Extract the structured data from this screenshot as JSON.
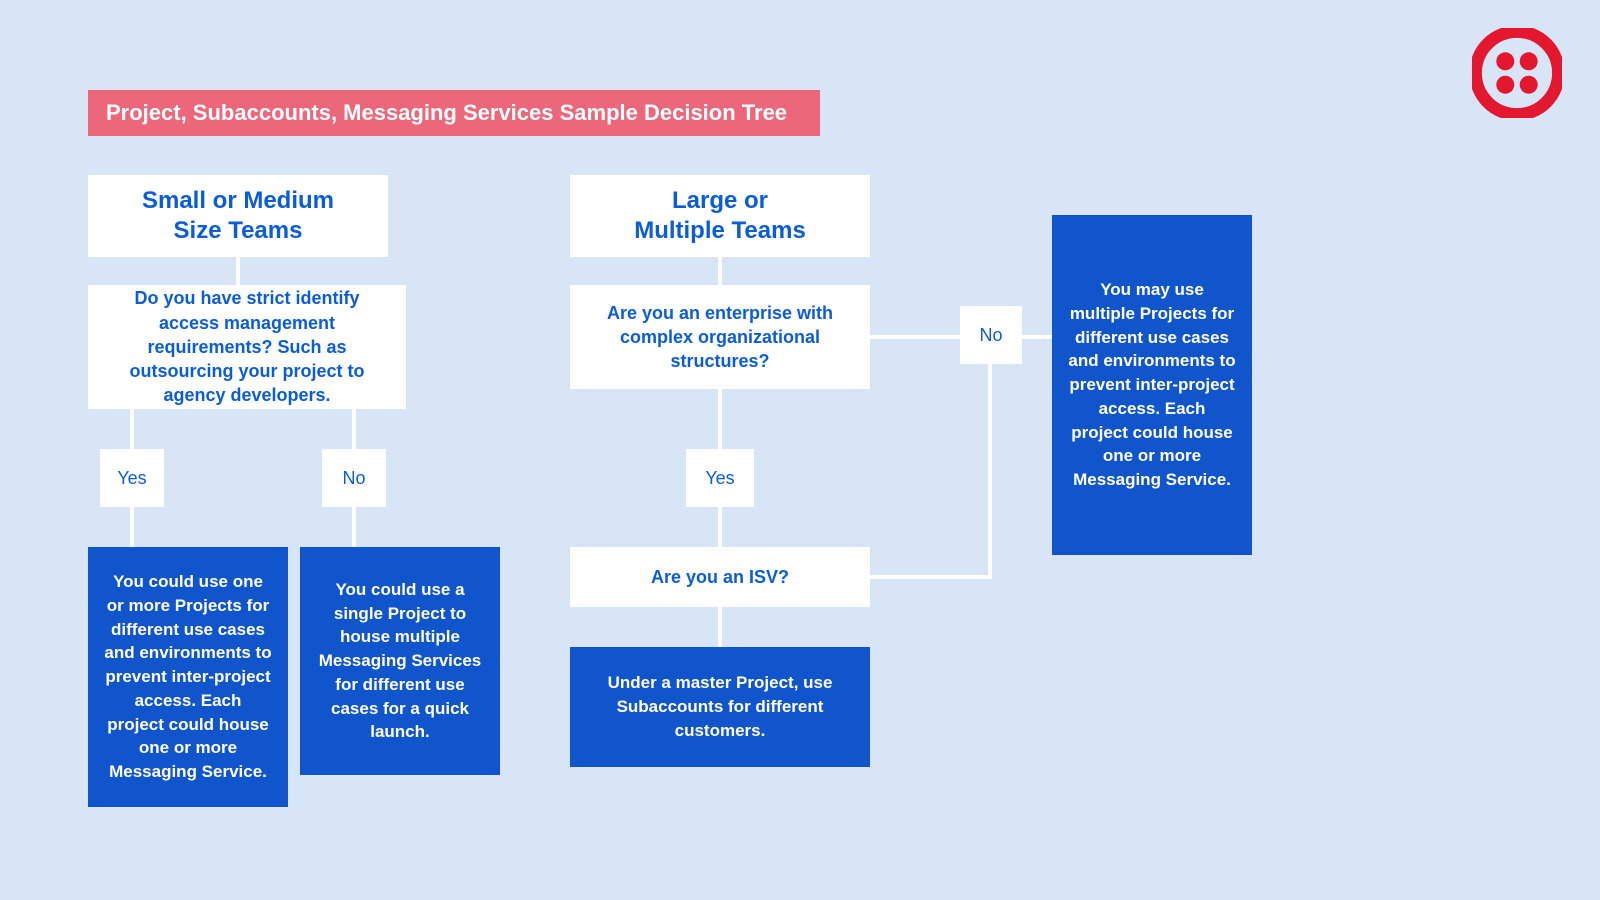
{
  "title": "Project, Subaccounts, Messaging Services Sample Decision Tree",
  "small": {
    "heading": "Small or Medium\nSize Teams",
    "q1": "Do you have strict identify access management requirements? Such as outsourcing your project to agency developers.",
    "yes": "Yes",
    "no": "No",
    "yes_result": "You could use  one or more Projects for different use cases and environments to prevent inter-project access. Each project could house one or more Messaging Service.",
    "no_result": "You could use a single Project to house multiple Messaging Services for different use cases for a quick launch."
  },
  "large": {
    "heading": "Large or\nMultiple Teams",
    "q1": "Are you an enterprise with complex organizational structures?",
    "yes": "Yes",
    "no": "No",
    "q2": "Are you an ISV?",
    "isv_result": "Under a master Project, use Subaccounts for different customers.",
    "no_result": "You may use multiple Projects for different use cases and environments to prevent inter-project access. Each project could house one or more Messaging Service."
  }
}
